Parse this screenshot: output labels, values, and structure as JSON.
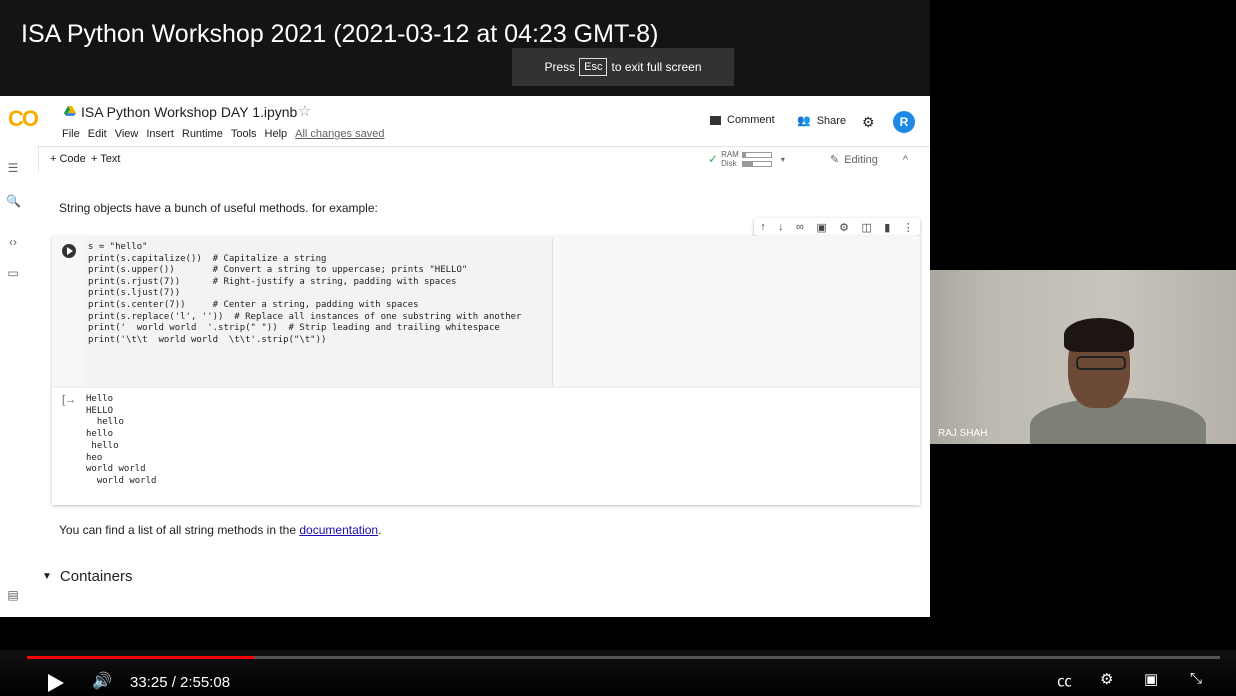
{
  "video": {
    "title": "ISA Python Workshop 2021 (2021-03-12 at 04:23 GMT-8)",
    "fullscreen_tip_pre": "Press",
    "fullscreen_tip_key": "Esc",
    "fullscreen_tip_post": "to exit full screen",
    "time_display": "33:25 / 2:55:08",
    "progress_fraction": 0.19
  },
  "colab": {
    "logo": "CO",
    "notebook_title": "ISA Python Workshop DAY 1.ipynb",
    "menu": [
      "File",
      "Edit",
      "View",
      "Insert",
      "Runtime",
      "Tools",
      "Help"
    ],
    "save_status": "All changes saved",
    "comment_label": "Comment",
    "share_label": "Share",
    "avatar_letter": "R",
    "add_code": "+ Code",
    "add_text": "+ Text",
    "ram_label": "RAM",
    "disk_label": "Disk",
    "editing_label": "Editing"
  },
  "notebook": {
    "intro_text": "String objects have a bunch of useful methods. for example:",
    "code": "s = \"hello\"\nprint(s.capitalize())  # Capitalize a string\nprint(s.upper())       # Convert a string to uppercase; prints \"HELLO\"\nprint(s.rjust(7))      # Right-justify a string, padding with spaces\nprint(s.ljust(7))\nprint(s.center(7))     # Center a string, padding with spaces\nprint(s.replace('l', ''))  # Replace all instances of one substring with another\nprint('  world world  '.strip(\" \"))  # Strip leading and trailing whitespace\nprint('\\t\\t  world world  \\t\\t'.strip(\"\\t\"))",
    "output": "Hello\nHELLO\n  hello\nhello\n hello\nheo\nworld world\n  world world",
    "doc_text_pre": "You can find a list of all string methods in the",
    "doc_link": "documentation",
    "doc_text_post": ".",
    "section_heading": "Containers"
  },
  "webcam": {
    "speaker_name": "RAJ SHAH"
  },
  "colors": {
    "progress": "#ff0000",
    "avatar": "#1e88e5",
    "colab_orange": "#f9ab00"
  }
}
